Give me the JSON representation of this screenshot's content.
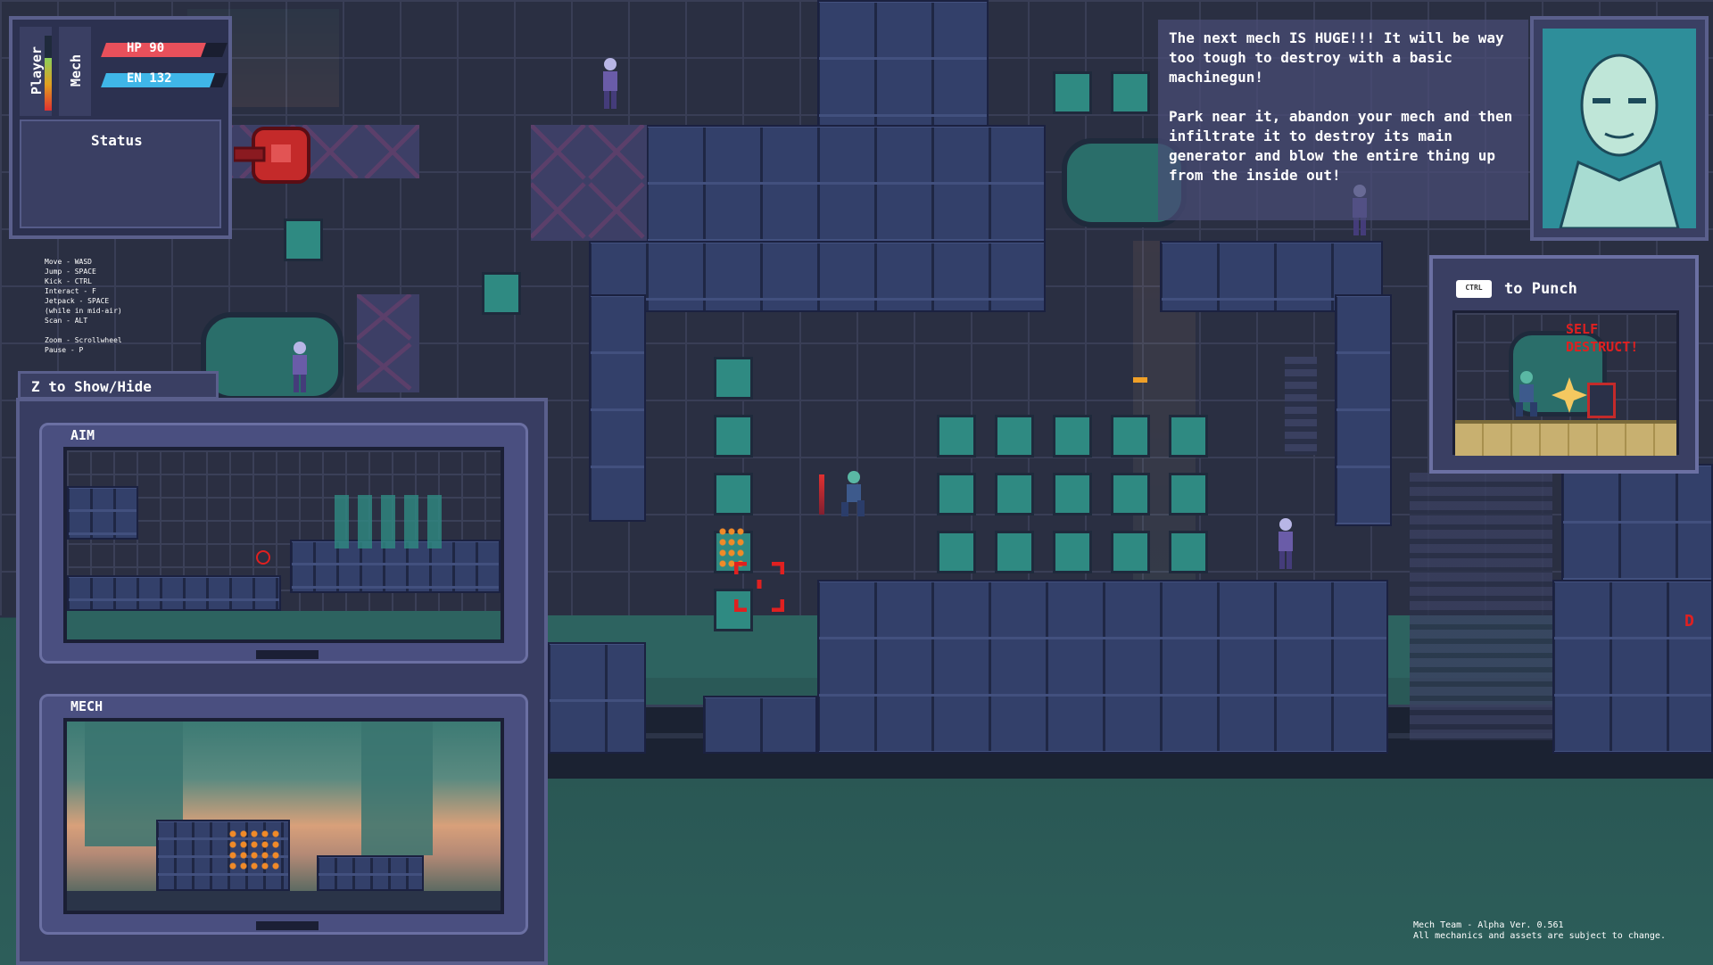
{
  "hud": {
    "player_label": "Player",
    "mech_label": "Mech",
    "hp_label": "HP 90",
    "en_label": "EN 132",
    "status_label": "Status",
    "hp_fraction": 0.82,
    "en_fraction": 0.9,
    "player_health_fraction": 0.7
  },
  "controls": {
    "lines": [
      "Move - WASD",
      "Jump - SPACE",
      "Kick - CTRL",
      "Interact - F",
      "Jetpack - SPACE",
      "(while in mid-air)",
      "Scan - ALT",
      "",
      "Zoom - Scrollwheel",
      "Pause - P"
    ]
  },
  "camera_panel": {
    "toggle_hint": "Z to Show/Hide",
    "aim_title": "AIM",
    "mech_title": "MECH"
  },
  "dialog": {
    "paragraph1": "The next mech IS HUGE!!! It will be way too tough to destroy with a basic machinegun!",
    "paragraph2": "Park near it, abandon your mech and then infiltrate it to destroy its main generator and blow the entire thing up from the inside out!"
  },
  "tutorial": {
    "key": "CTRL",
    "action": "to Punch",
    "sign": "SELF DESTRUCT!"
  },
  "footer": {
    "line1": "Mech Team - Alpha Ver. 0.561",
    "line2": "All mechanics and assets are subject to change."
  },
  "edge_marker": "D",
  "colors": {
    "hp_bar": "#e8505b",
    "en_bar": "#3fb6e8",
    "accent_red": "#e02020",
    "panel_purple": "#4a4f80",
    "teal_window": "#2f8a82"
  }
}
